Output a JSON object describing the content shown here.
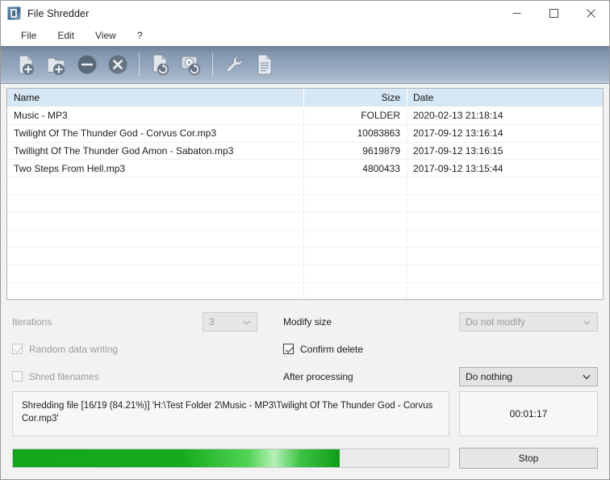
{
  "window": {
    "title": "File Shredder",
    "icon": "app-icon",
    "controls": {
      "minimize": "minimize-icon",
      "maximize": "maximize-icon",
      "close": "close-icon"
    }
  },
  "menu": {
    "items": [
      {
        "label": "File"
      },
      {
        "label": "Edit"
      },
      {
        "label": "View"
      },
      {
        "label": "?"
      }
    ]
  },
  "toolbar": {
    "buttons": [
      {
        "name": "add-file-icon",
        "tip": "Add file"
      },
      {
        "name": "add-folder-icon",
        "tip": "Add folder"
      },
      {
        "name": "remove-item-icon",
        "tip": "Remove"
      },
      {
        "name": "remove-all-icon",
        "tip": "Remove all"
      },
      {
        "name": "shred-files-icon",
        "tip": "Shred files"
      },
      {
        "name": "shred-disk-icon",
        "tip": "Shred free space"
      },
      {
        "name": "settings-wrench-icon",
        "tip": "Settings"
      },
      {
        "name": "report-log-icon",
        "tip": "Report"
      }
    ]
  },
  "filelist": {
    "columns": [
      {
        "key": "name",
        "label": "Name"
      },
      {
        "key": "size",
        "label": "Size"
      },
      {
        "key": "date",
        "label": "Date"
      }
    ],
    "rows": [
      {
        "name": "Music - MP3",
        "size": "FOLDER",
        "date": "2020-02-13 21:18:14"
      },
      {
        "name": "Twilight Of The Thunder God - Corvus Cor.mp3",
        "size": "10083863",
        "date": "2017-09-12 13:16:14"
      },
      {
        "name": "Twillight Of The Thunder God Amon - Sabaton.mp3",
        "size": "9619879",
        "date": "2017-09-12 13:16:15"
      },
      {
        "name": "Two Steps From Hell.mp3",
        "size": "4800433",
        "date": "2017-09-12 13:15:44"
      }
    ],
    "empty_row_count": 7
  },
  "options": {
    "iterations_label": "Iterations",
    "iterations_value": "3",
    "modify_size_label": "Modify size",
    "modify_size_value": "Do not modify",
    "random_data_label": "Random data writing",
    "confirm_delete_label": "Confirm delete",
    "shred_filenames_label": "Shred filenames",
    "after_processing_label": "After processing",
    "after_processing_value": "Do nothing"
  },
  "status": {
    "message": "Shredding file [16/19 (84.21%)] 'H:\\Test Folder 2\\Music - MP3\\Twilight Of The Thunder God - Corvus Cor.mp3'",
    "elapsed": "00:01:17"
  },
  "progress": {
    "percent": 75,
    "fill_color": "#16a81e",
    "stop_label": "Stop"
  },
  "colors": {
    "header_highlight": "#d6e7f5",
    "toolbar_gradient_top": "#6d7f93",
    "toolbar_gradient_bottom": "#c0ccda",
    "progress_green": "#16a81e",
    "window_bg": "#f2f2f2"
  }
}
